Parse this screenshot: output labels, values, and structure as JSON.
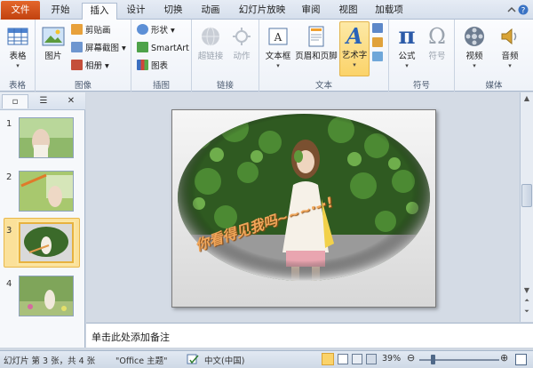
{
  "tabs": [
    "文件",
    "开始",
    "插入",
    "设计",
    "切换",
    "动画",
    "幻灯片放映",
    "审阅",
    "视图",
    "加载项"
  ],
  "ribbon": {
    "groups": {
      "table": "表格",
      "images": "图像",
      "illustrations": "插图",
      "links": "链接",
      "text": "文本",
      "symbols": "符号",
      "media": "媒体"
    },
    "buttons": {
      "table": "表格",
      "picture": "图片",
      "clipart": "剪贴画",
      "screenshot": "屏幕截图",
      "album": "相册",
      "shapes": "形状",
      "smartart": "SmartArt",
      "chart": "图表",
      "hyperlink": "超链接",
      "action": "动作",
      "textbox": "文本框",
      "header_footer": "页眉和页脚",
      "wordart": "艺术字",
      "equation": "公式",
      "symbol": "符号",
      "video": "视频",
      "audio": "音频"
    },
    "symbol_glyphs": {
      "equation": "π",
      "symbol": "Ω",
      "wordart": "A"
    }
  },
  "slides": [
    {
      "number": "1"
    },
    {
      "number": "2"
    },
    {
      "number": "3"
    },
    {
      "number": "4"
    }
  ],
  "slide": {
    "wordart_text": "你看得见我吗~~~·-·!"
  },
  "notes_placeholder": "单击此处添加备注",
  "status": {
    "slide_info": "幻灯片 第 3 张，共 4 张",
    "theme": "\"Office 主题\"",
    "language": "中文(中国)",
    "zoom": "39%"
  },
  "colors": {
    "file_tab": "#d24f1a",
    "selection": "#fbd36a",
    "accent": "#2b579a"
  }
}
